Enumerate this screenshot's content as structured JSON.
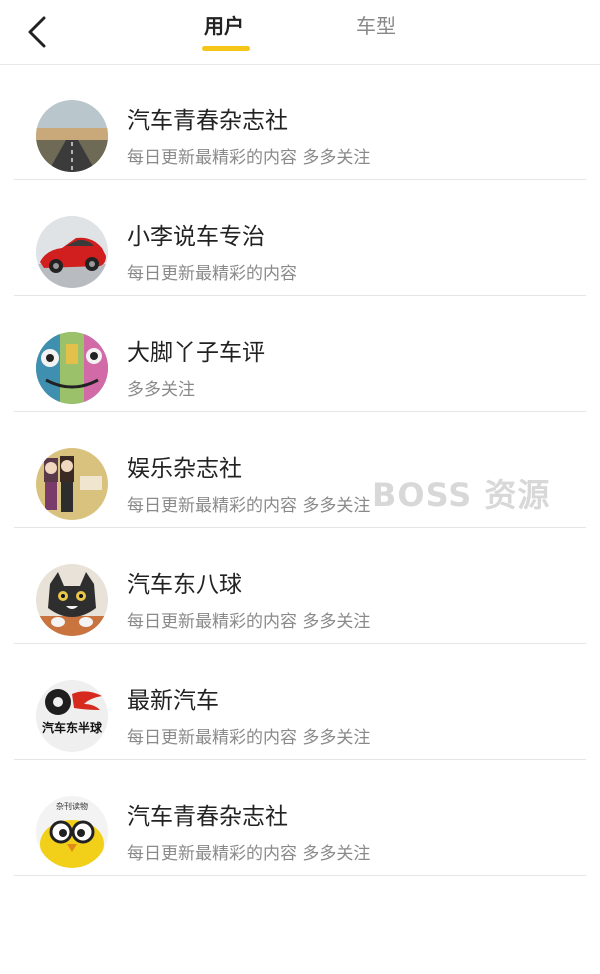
{
  "header": {
    "tabs": [
      {
        "label": "用户",
        "active": true
      },
      {
        "label": "车型",
        "active": false
      }
    ],
    "accent_color": "#f5c518"
  },
  "users": [
    {
      "name": "汽车青春杂志社",
      "desc": "每日更新最精彩的内容 多多关注",
      "avatar": "road-landscape"
    },
    {
      "name": "小李说车专治",
      "desc": "每日更新最精彩的内容",
      "avatar": "red-sports-car"
    },
    {
      "name": "大脚丫子车评",
      "desc": "多多关注",
      "avatar": "graffiti-art"
    },
    {
      "name": "娱乐杂志社",
      "desc": "每日更新最精彩的内容 多多关注",
      "avatar": "cartoon-girls"
    },
    {
      "name": "汽车东八球",
      "desc": "每日更新最精彩的内容 多多关注",
      "avatar": "kitten"
    },
    {
      "name": "最新汽车",
      "desc": "每日更新最精彩的内容 多多关注",
      "avatar": "tire-logo",
      "avatar_text": "汽车东半球"
    },
    {
      "name": "汽车青春杂志社",
      "desc": "每日更新最精彩的内容 多多关注",
      "avatar": "yellow-bird",
      "avatar_text": "杂刊读物"
    }
  ],
  "watermark": "BOSS 资源"
}
